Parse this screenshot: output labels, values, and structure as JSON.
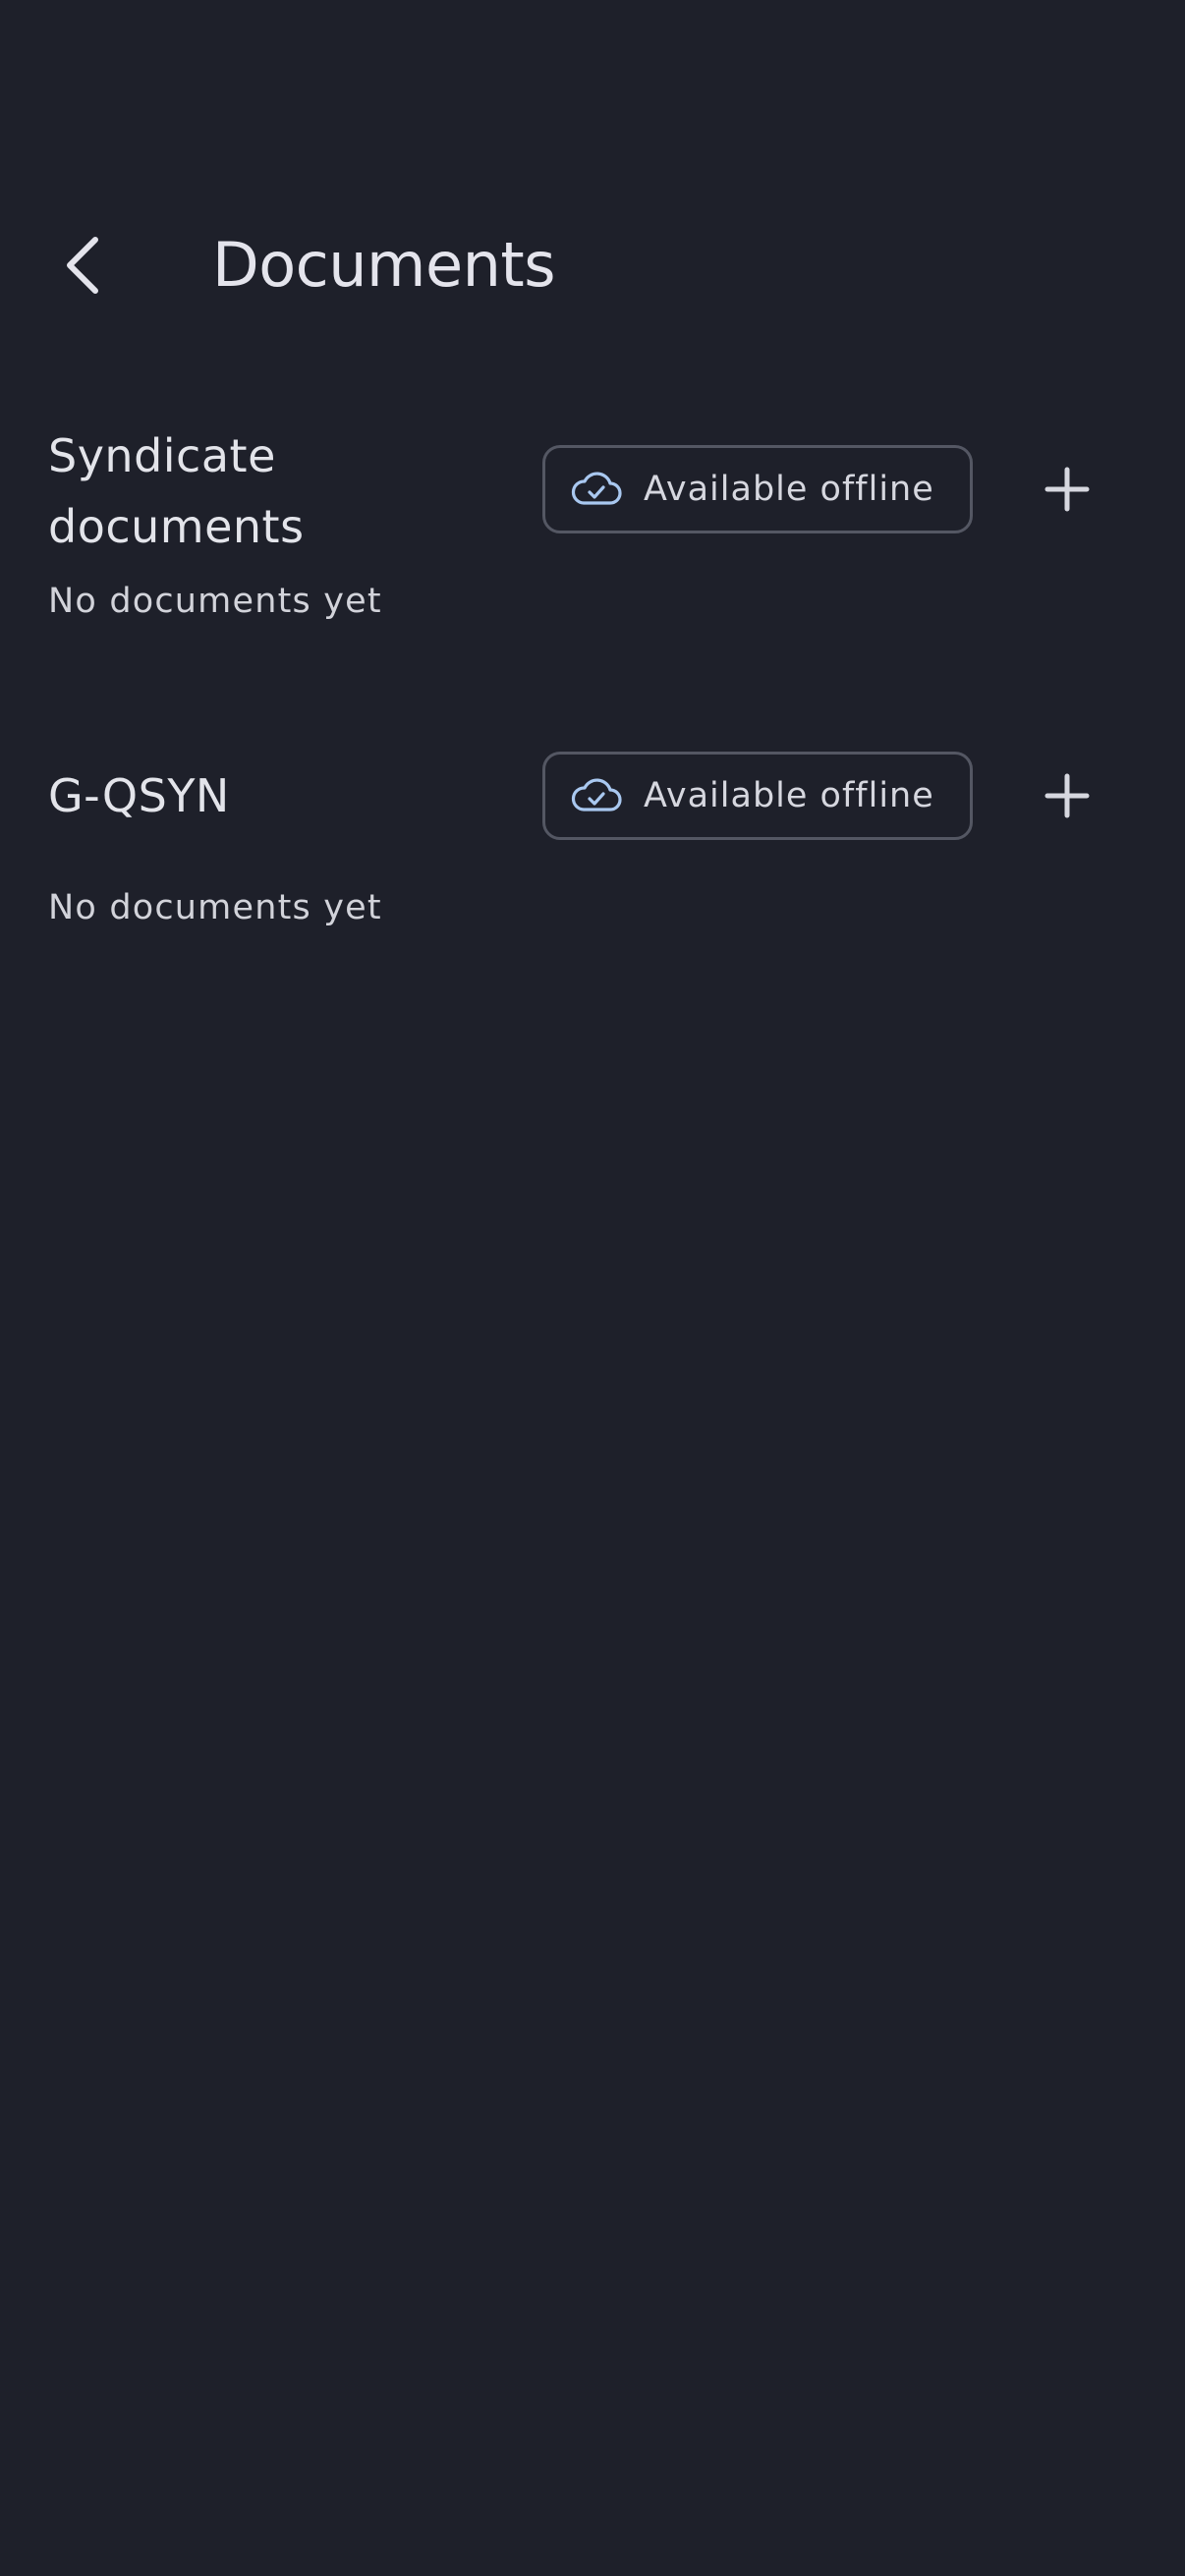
{
  "header": {
    "title": "Documents",
    "back_icon": "chevron-left-icon"
  },
  "sections": [
    {
      "title": "Syndicate documents",
      "offline_label": "Available offline",
      "offline_icon": "cloud-check-icon",
      "add_icon": "plus-icon",
      "empty_text": "No documents yet"
    },
    {
      "title": "G-QSYN",
      "offline_label": "Available offline",
      "offline_icon": "cloud-check-icon",
      "add_icon": "plus-icon",
      "empty_text": "No documents yet"
    }
  ],
  "colors": {
    "background": "#1e202a",
    "text": "#e3e4ea",
    "chip_border": "#545763",
    "cloud_icon": "#a9c8f0"
  }
}
